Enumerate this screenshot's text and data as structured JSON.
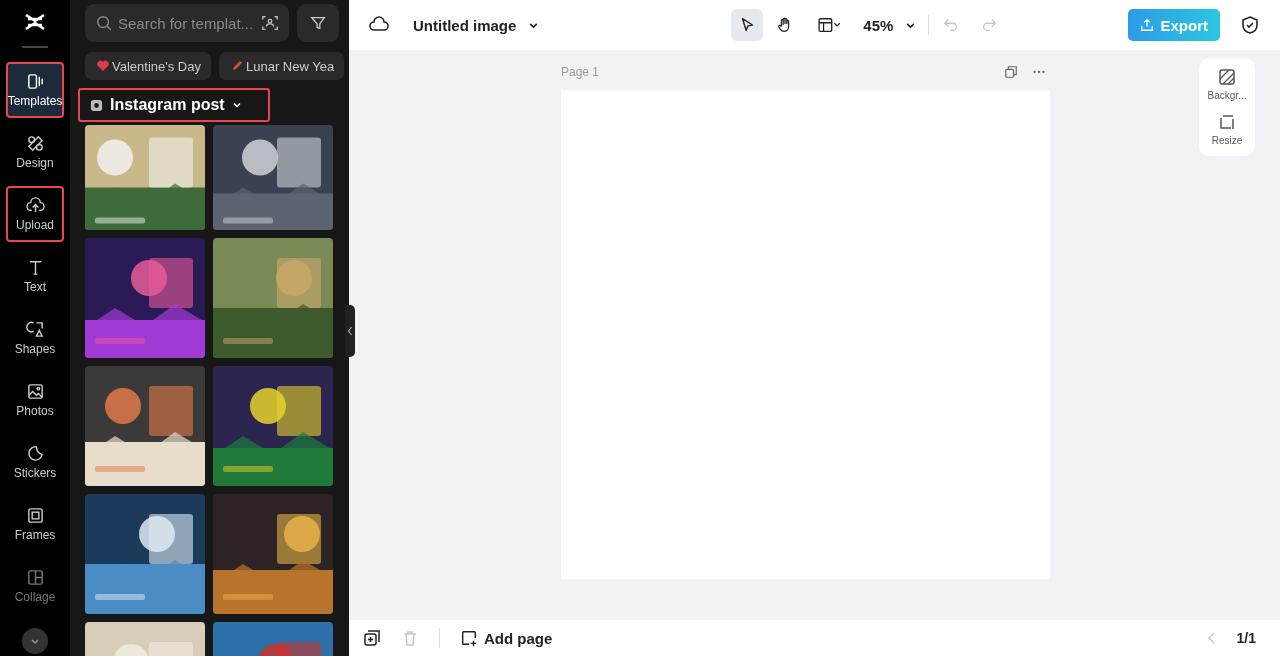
{
  "rail": [
    {
      "label": "Templates",
      "selected": true,
      "highlighted": true,
      "disabled": false
    },
    {
      "label": "Design",
      "selected": false,
      "highlighted": false,
      "disabled": false
    },
    {
      "label": "Upload",
      "selected": false,
      "highlighted": true,
      "disabled": false
    },
    {
      "label": "Text",
      "selected": false,
      "highlighted": false,
      "disabled": false
    },
    {
      "label": "Shapes",
      "selected": false,
      "highlighted": false,
      "disabled": false
    },
    {
      "label": "Photos",
      "selected": false,
      "highlighted": false,
      "disabled": false
    },
    {
      "label": "Stickers",
      "selected": false,
      "highlighted": false,
      "disabled": false
    },
    {
      "label": "Frames",
      "selected": false,
      "highlighted": false,
      "disabled": false
    },
    {
      "label": "Collage",
      "selected": false,
      "highlighted": false,
      "disabled": true
    }
  ],
  "panel": {
    "search": {
      "placeholder": "Search for templat..."
    },
    "chips": [
      {
        "kind": "heart",
        "label": "Valentine's Day"
      },
      {
        "kind": "pencil",
        "label": "Lunar New Yea"
      }
    ],
    "category": {
      "label": "Instagram post",
      "highlighted": true
    }
  },
  "topbar": {
    "title": "Untitled image",
    "zoom": "45%",
    "export": "Export"
  },
  "canvas": {
    "page_label": "Page 1"
  },
  "side_tools": [
    {
      "kind": "background",
      "label": "Backgr..."
    },
    {
      "kind": "resize",
      "label": "Resize"
    }
  ],
  "bottombar": {
    "add_page": "Add page",
    "pages": "1/1"
  }
}
